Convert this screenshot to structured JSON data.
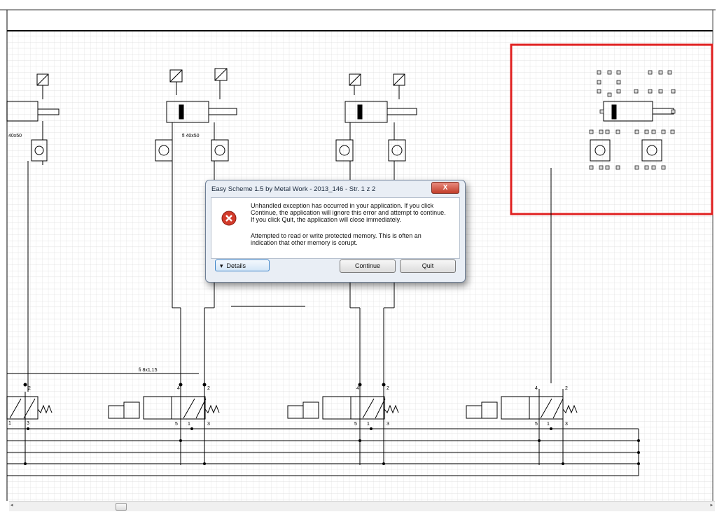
{
  "dialog": {
    "title": "Easy Scheme 1.5 by Metal Work - 2013_146 - Str. 1 z 2",
    "close_label": "X",
    "message_primary": "Unhandled exception has occurred in your application. If you click Continue, the application will ignore this error and attempt to continue. If you click Quit, the application will close immediately.",
    "message_secondary": "Attempted to read or write protected memory. This is often an indication that other memory is corupt.",
    "details_label": "Details",
    "continue_label": "Continue",
    "quit_label": "Quit"
  },
  "schematic": {
    "labels": {
      "cyl1": "40x50",
      "cyl2": "fi 40x50",
      "tube": "fi 8x1,15"
    },
    "port_numbers": [
      "2",
      "4",
      "1",
      "3",
      "5"
    ]
  },
  "colors": {
    "selection": "#e02020",
    "grid": "#d9d9d9",
    "line": "#000000"
  },
  "scrollbar": {
    "left_arrow": "◂",
    "right_arrow": "▸"
  }
}
